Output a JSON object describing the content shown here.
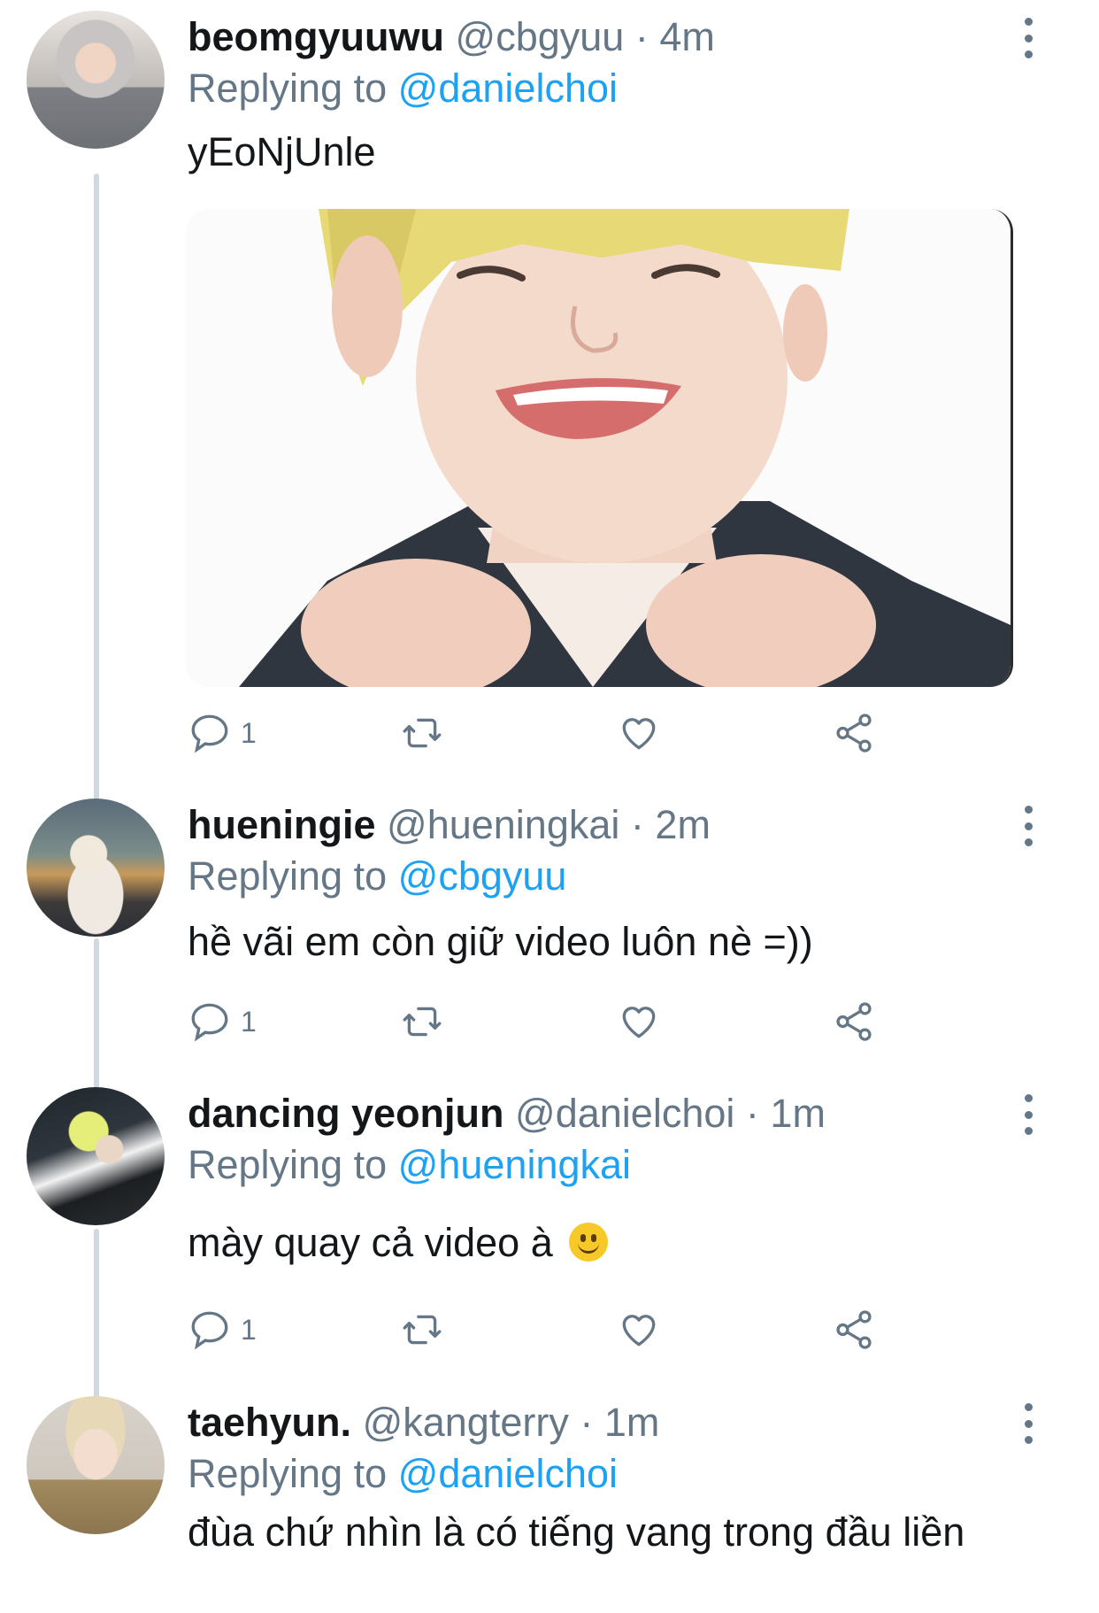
{
  "tweets": [
    {
      "display_name": "beomgyuuwu",
      "handle": "@cbgyuu",
      "time": "4m",
      "replying_prefix": "Replying to",
      "replying_to": "@danielchoi",
      "text": "yEoNjUnle",
      "has_media": true,
      "reply_count": "1"
    },
    {
      "display_name": "hueningie",
      "handle": "@hueningkai",
      "time": "2m",
      "replying_prefix": "Replying to",
      "replying_to": "@cbgyuu",
      "text": "hề vãi em còn giữ video luôn nè =))",
      "reply_count": "1"
    },
    {
      "display_name": "dancing yeonjun",
      "handle": "@danielchoi",
      "time": "1m",
      "replying_prefix": "Replying to",
      "replying_to": "@hueningkai",
      "text": "mày quay cả video à",
      "emoji": "slightly-smiling-face",
      "reply_count": "1"
    },
    {
      "display_name": "taehyun.",
      "handle": "@kangterry",
      "time": "1m",
      "replying_prefix": "Replying to",
      "replying_to": "@danielchoi",
      "text": "đùa chứ nhìn là có tiếng vang trong đầu liền"
    }
  ],
  "separator": "·",
  "icons": {
    "reply": "reply-bubble-icon",
    "retweet": "retweet-icon",
    "like": "heart-icon",
    "share": "share-icon",
    "more": "more-vertical-icon"
  },
  "colors": {
    "accent": "#1da1f2",
    "secondary_text": "#657786",
    "primary_text": "#14171a",
    "thread_line": "#cfd9de"
  }
}
